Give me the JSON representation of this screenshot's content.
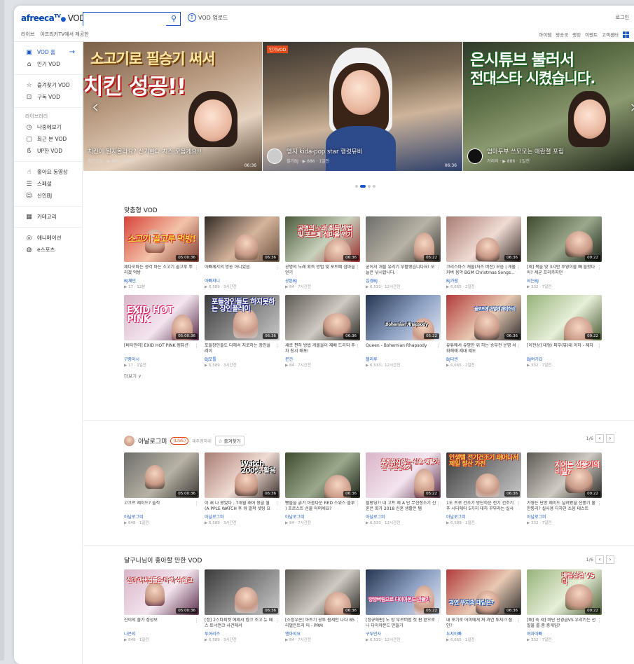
{
  "header": {
    "logo": "afreeca",
    "logo_tv": "TV",
    "logo_vod": "VOD",
    "search_placeholder": "",
    "upload_label": "VOD 업로드",
    "login": "로그인",
    "subnav": [
      "라이브",
      "아프리카TV에서 제공한"
    ],
    "topright": [
      "아이템",
      "방송국",
      "랭킹",
      "이벤트 ",
      "고객센터"
    ]
  },
  "sidebar": {
    "group1": [
      {
        "icon": "vod-icon",
        "label": "VOD 홈",
        "active": true
      },
      {
        "icon": "popular-icon",
        "label": "인기 VOD"
      }
    ],
    "group2": [
      {
        "icon": "star-icon",
        "label": "즐겨찾기 VOD"
      },
      {
        "icon": "subscribe-icon",
        "label": "구독 VOD"
      }
    ],
    "library_title": "라이브러리",
    "group3": [
      {
        "icon": "clock-icon",
        "label": "나중에보기"
      },
      {
        "icon": "recent-icon",
        "label": "최근 본 VOD"
      },
      {
        "icon": "up-icon",
        "label": "UP한 VOD"
      }
    ],
    "group4": [
      {
        "icon": "like-icon",
        "label": "좋아요 동영상"
      },
      {
        "icon": "list-icon",
        "label": "스페셜"
      },
      {
        "icon": "smile-icon",
        "label": "신인BJ"
      }
    ],
    "group5": [
      {
        "icon": "category-icon",
        "label": "카테고리"
      }
    ],
    "group6": [
      {
        "icon": "animation-icon",
        "label": "애니메이션"
      },
      {
        "icon": "esports-icon",
        "label": "e스포츠"
      }
    ]
  },
  "banner": {
    "slides": [
      {
        "big1": "소고기로 필승기 써서",
        "big2": "치킨 성공!!",
        "title": "치킨이 뭔지몰라요? 신기한다 치즈 모음게요!!",
        "meta": "치킨일상 · ▶ 886 · 1일전",
        "dur": "06:36"
      },
      {
        "tag": "인기VOD",
        "title": "엥지 kida-pop star 행렷뮤비",
        "meta": "필기BJ · ▶ 886 · 1일전",
        "dur": "06:36"
      },
      {
        "big1": "은시튜브 불러서",
        "big2": "전대스타 시켰습니다.",
        "title": "엄마두부 쓰모모는 애란졀 포립",
        "meta": "거리의 · ▶ 886 · 1일전",
        "dur": "06:36"
      }
    ]
  },
  "section1": {
    "title": "맞춤형 VOD",
    "more": "더보기 ∨",
    "cards": [
      {
        "dur": "05:00:36",
        "title": "제다오파는 생각 바는 소고기 골고루 뿌 리겠 먹방",
        "user": "BJ채민",
        "meta": "▶ 17 · 13분"
      },
      {
        "dur": "06:36",
        "title": "아빠께서의 방송 아니었음",
        "user": "아빠지니",
        "meta": "▶ 6,589 · 3시간전"
      },
      {
        "dur": "06:36",
        "title": "공명의 노래 획득 방법 및 포트폐 섬마을 얻기",
        "user": "공튼BJ",
        "meta": "▶ 84 · 7시간전"
      },
      {
        "dur": "05:22",
        "title": "굳어서 개를 유리기 부활했습니다요! 오늘은 낚시합니다.",
        "user": "심경BJ",
        "meta": "▶ 6,533 · 12시간전"
      },
      {
        "dur": "06:36",
        "title": "크리스마스 캐롤(처즈 버전) 모음 | 게롤 커버 음악 BGM Christmas Songs...",
        "user": "BJ가람",
        "meta": "▶ 6,665 · 2일전"
      },
      {
        "dur": "09:22",
        "title": "[제] 목을 맞 3시반 후영이를 빼 들렸다어? 세균 프리카지던",
        "user": "씨는BJ",
        "meta": "▶ 332 · 7일전"
      },
      {
        "dur": "05:00:36",
        "title": "[비타민의] EXID HOT PINK 컴퓨션",
        "user": "구중이시",
        "meta": "▶ 17 · 1일전"
      },
      {
        "dur": "06:36",
        "title": "포들장인들도 다해서 지로하는 장인플 레이",
        "user": "BJ포틀",
        "meta": "▶ 6,589 · 3시간전"
      },
      {
        "dur": "06:36",
        "title": "새로 편하 방법 게롤을이 재배 드리되 주차 칭서 배포!",
        "user": "문건",
        "meta": "▶ 84 · 7시간전"
      },
      {
        "dur": "05:22",
        "title": "Queen - Bohemian Rhapsody",
        "user": "첼리루",
        "meta": "▶ 6,533 · 12시간전"
      },
      {
        "dur": "06:36",
        "title": "유튜에서 유명한 위 하는 승부전 운명 서 화해해 제대 제도",
        "user": "BJ다빈",
        "meta": "▶ 6,665 · 2일전"
      },
      {
        "dur": "09:22",
        "title": "[이전상] 대형/ 피부(뷰)대 아하 - 제차",
        "user": "BJ여기요",
        "meta": "▶ 332 · 7일전"
      }
    ]
  },
  "section2": {
    "channel": "아날로그미",
    "live": "LIVE",
    "sub": "재주정하네",
    "fav": "☆ 즐겨찾기",
    "pager": "1/6",
    "cards": [
      {
        "dur": "05:00:36",
        "title": "고크르 제이드? 솔직",
        "user": "아날로그미",
        "meta": "▶ 848 · 1일전"
      },
      {
        "dur": "06:36",
        "title": "이 새 나 왔었다 , 7개월 래어 왕글 월 (A PPLE WATCH 후 워 발적 셋팅 요리)",
        "user": "아날로그미",
        "meta": "▶ 6,589 · 3시간전"
      },
      {
        "dur": "06:36",
        "title": "빵들을 긁기 아름다운 RED 스위스 블루 ) 프르스트 선물 어떠세요?",
        "user": "아날로그미",
        "meta": "▶ 84 · 7시간전"
      },
      {
        "dur": "05:22",
        "title": "블랑딩?! 네 고트 제 A 단 무선청소기 신혼은 회가 2018 신혼 생활은 템",
        "user": "아날로그미",
        "meta": "▶ 6,533 · 12시간전"
      },
      {
        "dur": "06:36",
        "title": "1도 트로 건조기 방단하운 전기 건조기 푸 시터에어 5가지 대하 꾸부라는 실사용",
        "user": "아날로그미",
        "meta": "▶ 6,589 · 1일전"
      },
      {
        "dur": "09:22",
        "title": "가영는 단방 제이드 날려봤을 선풍기 물 한통리? 실사용 디자인 소음 테스트",
        "user": "아날로그미",
        "meta": "▶ 332 · 7일전"
      }
    ]
  },
  "section3": {
    "title": "달구니님이 좋아할 만한 VOD",
    "pager": "1/6",
    "cards": [
      {
        "dur": "05:00:36",
        "title": "신이의 출가 정성보",
        "user": "나은지",
        "meta": "▶ 848 · 1일전"
      },
      {
        "dur": "06:36",
        "title": "[정] 2스타피켓 에제서 빙크 조고 뉴 페스 토너먼크 사건에서",
        "user": "푸어리즈",
        "meta": "▶ 6,589 · 3시간전"
      },
      {
        "dur": "06:36",
        "title": "[소정우온] 아트기 공투 원세만 나다 85 리벌든트리 어 - PRM",
        "user": "엔아지요",
        "meta": "▶ 84 · 7시간전"
      },
      {
        "dur": "05:22",
        "title": "[정규헤판] 노 망 부르버범 첫 판 받으로 나 다이야몬드 만들기",
        "user": "구두만사",
        "meta": "▶ 6,533 · 12시간전"
      },
      {
        "dur": "06:36",
        "title": "내 포기로 어미에게 쳐 과연 뚜지!? 잠 인?",
        "user": "두지아빠",
        "meta": "▶ 6,665 · 1일전"
      },
      {
        "dur": "09:22",
        "title": "[배] 숙 세] 비단 신경급VS 우리키는 선 질물 를 중 중게임?",
        "user": "여자아빠",
        "meta": "▶ 332 · 7일전"
      }
    ]
  },
  "colors": {
    "accent": "#1a57c7",
    "live": "#e64a19"
  }
}
